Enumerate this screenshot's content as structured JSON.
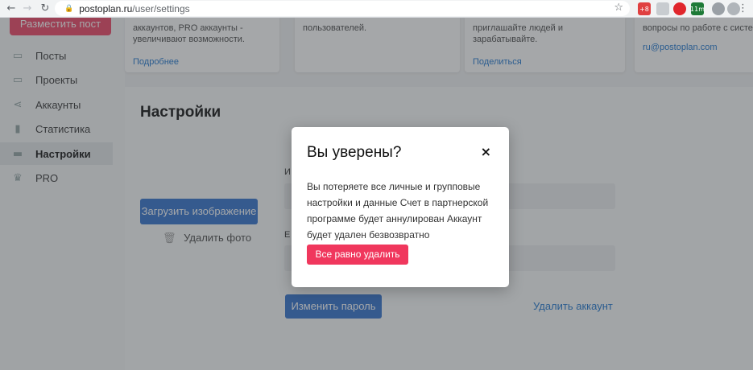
{
  "browser": {
    "url_host": "postoplan.ru",
    "url_path": "/user/settings",
    "nav_back": "←",
    "nav_forward": "→",
    "nav_reload": "↻",
    "lock_icon": "🔒",
    "bookmark_star": "☆",
    "ext_badge": "+8",
    "ext_badge_2": "11m",
    "menu": "⋮"
  },
  "sidebar": {
    "post_button": "Разместить пост",
    "items": [
      {
        "label": "Посты",
        "icon": "image-icon",
        "glyph": "▭"
      },
      {
        "label": "Проекты",
        "icon": "monitor-icon",
        "glyph": "▭"
      },
      {
        "label": "Аккаунты",
        "icon": "share-icon",
        "glyph": "⋖"
      },
      {
        "label": "Статистика",
        "icon": "bar-chart-icon",
        "glyph": "▮"
      },
      {
        "label": "Настройки",
        "icon": "settings-icon",
        "glyph": "▬"
      },
      {
        "label": "PRO",
        "icon": "crown-icon",
        "glyph": "♛"
      }
    ]
  },
  "cards": [
    {
      "text": "аккаунтов, PRO аккаунты - увеличивают возможности.",
      "link": "Подробнее"
    },
    {
      "text": "пользователей.",
      "link": ""
    },
    {
      "text": "приглашайте людей и зарабатывайте.",
      "link": "Поделиться"
    },
    {
      "text": "вопросы по работе с систем",
      "link": "ru@postoplan.com"
    }
  ],
  "settings": {
    "title": "Настройки",
    "upload_button": "Загрузить изображение",
    "delete_photo": "Удалить фото",
    "trash_glyph": "🗑",
    "label_1": "И",
    "label_2": "E",
    "change_password": "Изменить пароль",
    "delete_account": "Удалить аккаунт"
  },
  "modal": {
    "title": "Вы уверены?",
    "close": "×",
    "text": "Вы потеряете все личные и групповые настройки и данные Счет в партнерской программе будет аннулирован Аккаунт будет удален безвозвратно",
    "confirm": "Все равно удалить"
  },
  "colors": {
    "accent_red": "#f0375d",
    "accent_blue": "#3f7ad1",
    "link_blue": "#2d7fd3"
  }
}
